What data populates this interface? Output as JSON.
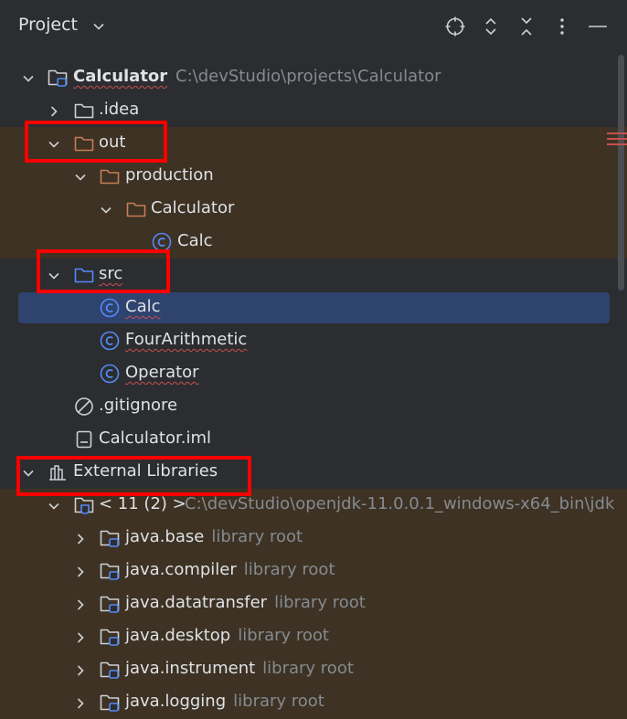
{
  "header": {
    "title": "Project",
    "icons": [
      "locate-icon",
      "expand-icon",
      "collapse-icon",
      "more-options-icon",
      "minimize-icon"
    ]
  },
  "tree": {
    "root": {
      "name": "Calculator",
      "path": "C:\\devStudio\\projects\\Calculator"
    },
    "idea": ".idea",
    "out": "out",
    "production": "production",
    "out_calculator": "Calculator",
    "out_calc": "Calc",
    "src": "src",
    "src_calc": "Calc",
    "four_arithmetic": "FourArithmetic",
    "operator": "Operator",
    "gitignore": ".gitignore",
    "iml": "Calculator.iml",
    "external_libraries": "External Libraries",
    "jdk": {
      "name": "< 11 (2) >",
      "path": "C:\\devStudio\\openjdk-11.0.0.1_windows-x64_bin\\jdk"
    },
    "libraries": [
      {
        "name": "java.base",
        "hint": "library root"
      },
      {
        "name": "java.compiler",
        "hint": "library root"
      },
      {
        "name": "java.datatransfer",
        "hint": "library root"
      },
      {
        "name": "java.desktop",
        "hint": "library root"
      },
      {
        "name": "java.instrument",
        "hint": "library root"
      },
      {
        "name": "java.logging",
        "hint": "library root"
      }
    ]
  },
  "colors": {
    "background": "#2b2d30",
    "excluded_band": "#3d3223",
    "selection": "#2e436e",
    "highlight_box": "#ff0000",
    "class_icon": "#548af7",
    "excluded_folder": "#c77d55"
  }
}
